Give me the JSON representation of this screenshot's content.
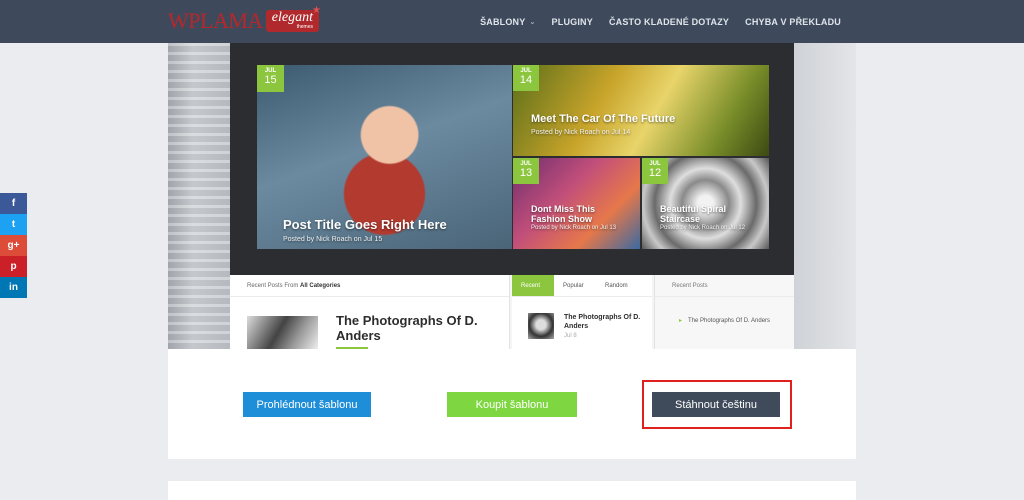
{
  "header": {
    "logo": {
      "wp": "WP",
      "lama": "LAMA",
      "badge_main": "elegant",
      "badge_sub": "themes"
    },
    "nav": [
      {
        "label": "ŠABLONY",
        "has_dropdown": true,
        "icon": "chevron-down-icon"
      },
      {
        "label": "PLUGINY"
      },
      {
        "label": "ČASTO KLADENÉ DOTAZY"
      },
      {
        "label": "CHYBA V PŘEKLADU"
      }
    ]
  },
  "social": [
    {
      "label": "f",
      "icon": "facebook-icon",
      "color": "#3b5998"
    },
    {
      "label": "t",
      "icon": "twitter-icon",
      "color": "#1da1f2"
    },
    {
      "label": "g+",
      "icon": "google-plus-icon",
      "color": "#dd4b39"
    },
    {
      "label": "p",
      "icon": "pinterest-icon",
      "color": "#cb2027"
    },
    {
      "label": "in",
      "icon": "linkedin-icon",
      "color": "#0077b5"
    }
  ],
  "preview": {
    "featured": [
      {
        "month": "JUL",
        "day": "15",
        "title": "Post Title Goes Right Here",
        "meta": "Posted by Nick Roach on Jul 15"
      },
      {
        "month": "JUL",
        "day": "14",
        "title": "Meet The Car Of The Future",
        "meta": "Posted by Nick Roach on Jul 14"
      },
      {
        "month": "JUL",
        "day": "13",
        "title": "Dont Miss This Fashion Show",
        "meta": "Posted by Nick Roach on Jul 13"
      },
      {
        "month": "JUL",
        "day": "12",
        "title": "Beautiful Spiral Staircase",
        "meta": "Posted by Nick Roach on Jul 12"
      }
    ],
    "recent_header_prefix": "Recent Posts From",
    "recent_header_bold": "All Categories",
    "recent_post_title": "The Photographs Of D. Anders",
    "tabs": [
      "Recent",
      "Popular",
      "Random"
    ],
    "tab_post_title": "The Photographs Of D. Anders",
    "tab_post_date": "Jul 8",
    "sidebar_header": "Recent Posts",
    "sidebar_item": "The Photographs Of D. Anders"
  },
  "buttons": {
    "preview": "Prohlédnout šablonu",
    "buy": "Koupit šablonu",
    "download": "Stáhnout češtinu"
  },
  "colors": {
    "topbar": "#3e4a5c",
    "accent_green": "#8cc63f",
    "btn_blue": "#1e8ed8",
    "btn_green": "#7ed641",
    "btn_dark": "#3f4b5b",
    "highlight_red": "#e01f1f"
  }
}
